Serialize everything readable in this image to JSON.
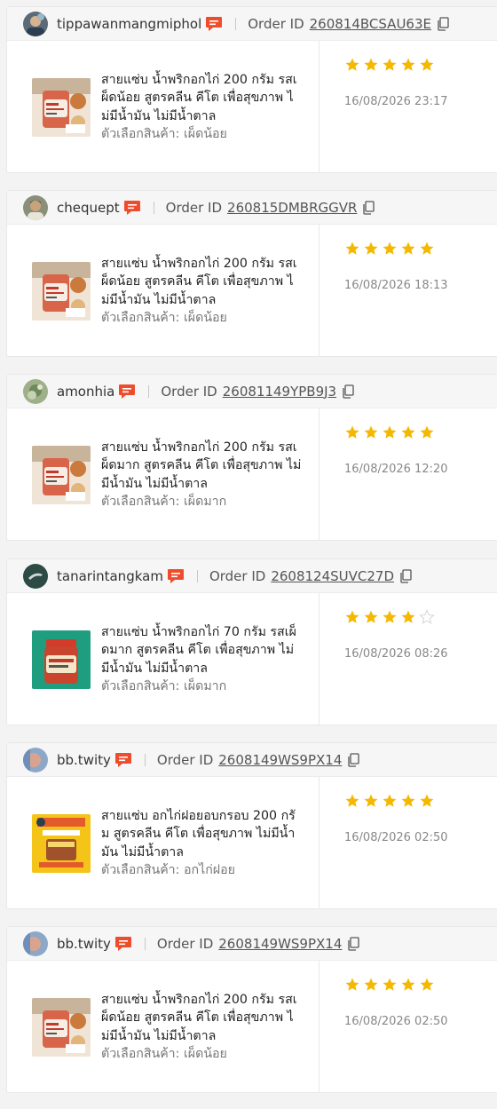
{
  "labels": {
    "order_id_prefix": "Order ID",
    "variation_prefix": "ตัวเลือกสินค้า: "
  },
  "colors": {
    "star_filled": "#f5b800",
    "star_empty": "#d8d8d8",
    "chat_icon": "#ee4d2d"
  },
  "reviews": [
    {
      "username": "tippawanmangmiphol",
      "avatar": "avatar-cartoon-icon",
      "order_id": "260814BCSAU63E",
      "product_name": "สายแซ่บ น้ำพริกอกไก่ 200 กรัม รสเผ็ดน้อย สูตรคลีน คีโต เพื่อสุขภาพ ไม่มีน้ำมัน ไม่มีน้ำตาล",
      "variation": "เผ็ดน้อย",
      "thumb": "jar-photo",
      "rating": 5,
      "date": "16/08/2026 23:17"
    },
    {
      "username": "chequept",
      "avatar": "avatar-person-icon",
      "order_id": "260815DMBRGGVR",
      "product_name": "สายแซ่บ น้ำพริกอกไก่ 200 กรัม รสเผ็ดน้อย สูตรคลีน คีโต เพื่อสุขภาพ ไม่มีน้ำมัน ไม่มีน้ำตาล",
      "variation": "เผ็ดน้อย",
      "thumb": "jar-photo",
      "rating": 5,
      "date": "16/08/2026 18:13"
    },
    {
      "username": "amonhia",
      "avatar": "avatar-nature-icon",
      "order_id": "26081149YPB9J3",
      "product_name": "สายแซ่บ น้ำพริกอกไก่ 200 กรัม รสเผ็ดมาก สูตรคลีน คีโต เพื่อสุขภาพ ไม่มีน้ำมัน ไม่มีน้ำตาล",
      "variation": "เผ็ดมาก",
      "thumb": "jar-photo",
      "rating": 5,
      "date": "16/08/2026 12:20"
    },
    {
      "username": "tanarintangkam",
      "avatar": "avatar-dark-icon",
      "order_id": "2608124SUVC27D",
      "product_name": "สายแซ่บ น้ำพริกอกไก่ 70 กรัม รสเผ็ดมาก สูตรคลีน คีโต เพื่อสุขภาพ ไม่มีน้ำมัน ไม่มีน้ำตาล",
      "variation": "เผ็ดมาก",
      "thumb": "jar-green",
      "rating": 4,
      "date": "16/08/2026 08:26"
    },
    {
      "username": "bb.twity",
      "avatar": "avatar-face-icon",
      "order_id": "2608149WS9PX14",
      "product_name": "สายแซ่บ อกไก่ฝอยอบกรอบ 200 กรัม สูตรคลีน คีโต เพื่อสุขภาพ ไม่มีน้ำมัน ไม่มีน้ำตาล",
      "variation": "อกไก่ฝอย",
      "thumb": "bag-yellow",
      "rating": 5,
      "date": "16/08/2026 02:50"
    },
    {
      "username": "bb.twity",
      "avatar": "avatar-face-icon",
      "order_id": "2608149WS9PX14",
      "product_name": "สายแซ่บ น้ำพริกอกไก่ 200 กรัม รสเผ็ดน้อย สูตรคลีน คีโต เพื่อสุขภาพ ไม่มีน้ำมัน ไม่มีน้ำตาล",
      "variation": "เผ็ดน้อย",
      "thumb": "jar-photo",
      "rating": 5,
      "date": "16/08/2026 02:50"
    }
  ]
}
